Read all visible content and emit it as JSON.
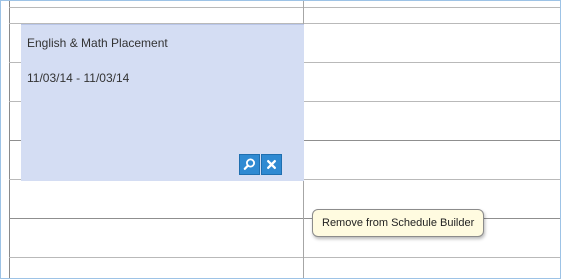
{
  "event": {
    "title": "English & Math Placement",
    "dates": "11/03/14 - 11/03/14",
    "background_color": "#d4ddf3",
    "actions": [
      {
        "name": "view",
        "icon": "magnifier-icon"
      },
      {
        "name": "remove",
        "icon": "close-icon"
      }
    ],
    "button_color": "#2f8ad2"
  },
  "tooltip": {
    "text": "Remove from Schedule Builder",
    "background_color": "#fffbe0"
  }
}
